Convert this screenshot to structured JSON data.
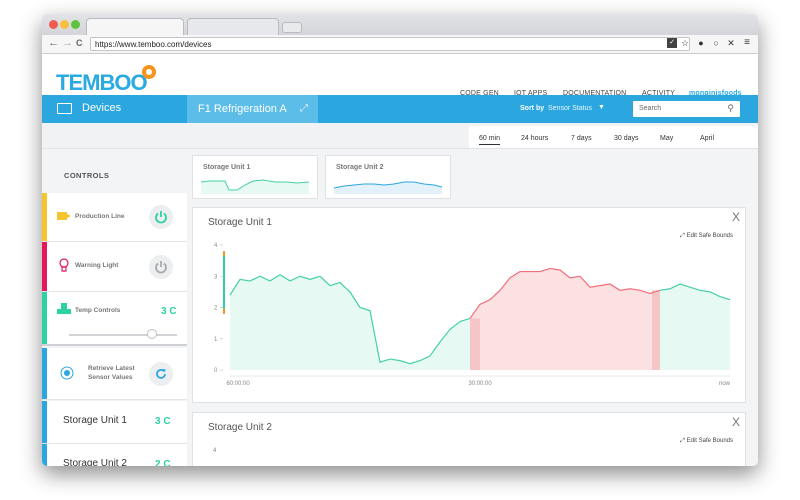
{
  "browser": {
    "url": "https://www.temboo.com/devices",
    "colors": {
      "close": "#ee5b53",
      "minimize": "#f7be3f",
      "zoom": "#5fc23d"
    }
  },
  "header": {
    "logo": "TEMBOO",
    "nav": [
      "CODE GEN",
      "IOT APPS",
      "DOCUMENTATION",
      "ACTIVITY"
    ],
    "user": "monginisfoods"
  },
  "devicebar": {
    "title": "Devices",
    "selected_device": "F1 Refrigeration A",
    "sort_label": "Sort by",
    "sort_value": "Sensor Status",
    "search_placeholder": "Search"
  },
  "time_filters": {
    "options": [
      "60 min",
      "24 hours",
      "7 days",
      "30 days",
      "May",
      "April"
    ],
    "active": "60 min"
  },
  "sidebar": {
    "title": "CONTROLS",
    "controls": [
      {
        "label": "Production Line",
        "color": "#f5c52e",
        "state": "on"
      },
      {
        "label": "Warning Light",
        "color": "#e5175a",
        "state": "off"
      },
      {
        "label": "Temp Controls",
        "color": "#2ed1a2",
        "value": "3 C",
        "slider_level": 0.78
      },
      {
        "label": "Retrieve Latest Sensor Values",
        "line1": "Retrieve Latest",
        "line2": "Sensor Values",
        "color": "#2ca6df"
      }
    ],
    "units": [
      {
        "name": "Storage Unit 1",
        "value": "3 C",
        "color": "#2ca6df"
      },
      {
        "name": "Storage Unit 2",
        "value": "2 C",
        "color": "#2ca6df"
      }
    ]
  },
  "mini_cards": [
    {
      "title": "Storage Unit 1"
    },
    {
      "title": "Storage Unit 2"
    }
  ],
  "cards": [
    {
      "title": "Storage Unit 1",
      "safe_bounds": "Edit Safe Bounds",
      "close": "X"
    },
    {
      "title": "Storage Unit 2",
      "safe_bounds": "Edit Safe Bounds",
      "close": "X"
    }
  ],
  "chart_data": {
    "type": "area",
    "title": "Storage Unit 1",
    "xlabel": "",
    "ylabel": "",
    "ylim": [
      0,
      4
    ],
    "yticks": [
      "0",
      "1",
      "2",
      "3",
      "4"
    ],
    "xticks": [
      "60:00:00",
      "30:00:00",
      "now"
    ],
    "safe_bounds": [
      1.8,
      3.8
    ],
    "colors": {
      "normal": "#45d0a5",
      "normal_fill": "#e6f9f3",
      "alert": "#f0707a",
      "alert_fill": "#fbe1e1"
    },
    "x": [
      0,
      2,
      4,
      6,
      8,
      10,
      12,
      14,
      16,
      18,
      20,
      22,
      24,
      26,
      28,
      30,
      32,
      34,
      36,
      38,
      40,
      42,
      44,
      46,
      48,
      50,
      52,
      54,
      56,
      58,
      60,
      62,
      64,
      66,
      68,
      70,
      72,
      74,
      76,
      78,
      80,
      82,
      84,
      86,
      88,
      90,
      92,
      94,
      96,
      98,
      100
    ],
    "values": [
      2.4,
      2.9,
      2.85,
      3.0,
      2.85,
      3.05,
      2.85,
      3.0,
      2.9,
      3.0,
      2.7,
      2.8,
      2.5,
      2.0,
      1.9,
      0.25,
      0.35,
      0.3,
      0.2,
      0.3,
      0.45,
      0.9,
      1.3,
      1.55,
      1.65,
      2.1,
      2.25,
      2.55,
      2.95,
      3.15,
      3.15,
      3.15,
      3.25,
      3.2,
      2.95,
      3.0,
      2.65,
      2.7,
      2.75,
      2.55,
      2.6,
      2.55,
      2.45,
      2.55,
      2.6,
      2.75,
      2.65,
      2.55,
      2.5,
      2.35,
      2.25
    ],
    "alert_range": [
      24,
      43
    ]
  },
  "chart2_data": {
    "type": "area",
    "title": "Storage Unit 2",
    "yticks": [
      "4"
    ]
  }
}
